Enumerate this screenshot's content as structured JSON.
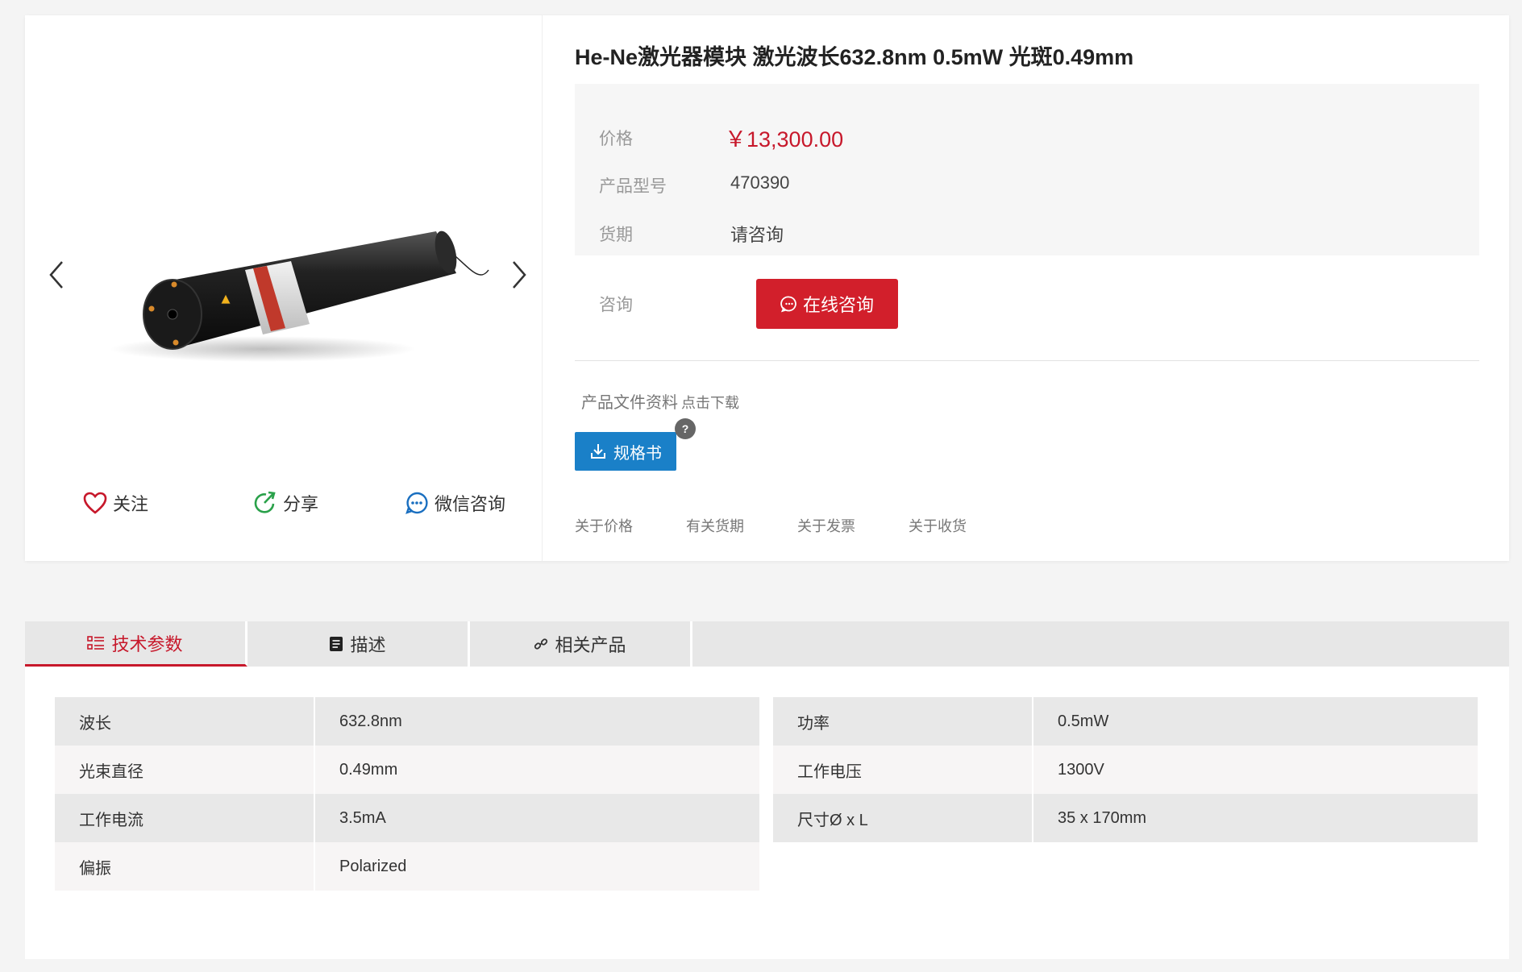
{
  "product": {
    "title": "He-Ne激光器模块 激光波长632.8nm 0.5mW 光斑0.49mm",
    "price_label": "价格",
    "price": "￥13,300.00",
    "model_label": "产品型号",
    "model": "470390",
    "delivery_label": "货期",
    "delivery": "请咨询",
    "consult_label": "咨询",
    "consult_button": "在线咨询"
  },
  "gallery": {
    "image_icon": "laser-module-photo",
    "follow": "关注",
    "share": "分享",
    "wechat": "微信咨询"
  },
  "docs": {
    "heading": "产品文件资料",
    "hint": "点击下载",
    "spec_button": "规格书",
    "help": "?"
  },
  "info_links": [
    "关于价格",
    "有关货期",
    "关于发票",
    "关于收货"
  ],
  "tabs": [
    {
      "label": "技术参数",
      "icon": "list-icon",
      "active": true
    },
    {
      "label": "描述",
      "icon": "document-icon",
      "active": false
    },
    {
      "label": "相关产品",
      "icon": "link-icon",
      "active": false
    }
  ],
  "specs_left": [
    {
      "key": "波长",
      "value": "632.8nm"
    },
    {
      "key": "光束直径",
      "value": "0.49mm"
    },
    {
      "key": "工作电流",
      "value": "3.5mA"
    },
    {
      "key": "偏振",
      "value": "Polarized"
    }
  ],
  "specs_right": [
    {
      "key": "功率",
      "value": "0.5mW"
    },
    {
      "key": "工作电压",
      "value": "1300V"
    },
    {
      "key": "尺寸Ø x L",
      "value": "35 x 170mm"
    }
  ],
  "colors": {
    "accent_red": "#c7182b",
    "button_red": "#d21f2b",
    "download_blue": "#1a80c8",
    "share_green": "#2aa14a",
    "wechat_blue": "#1a6fc0"
  }
}
